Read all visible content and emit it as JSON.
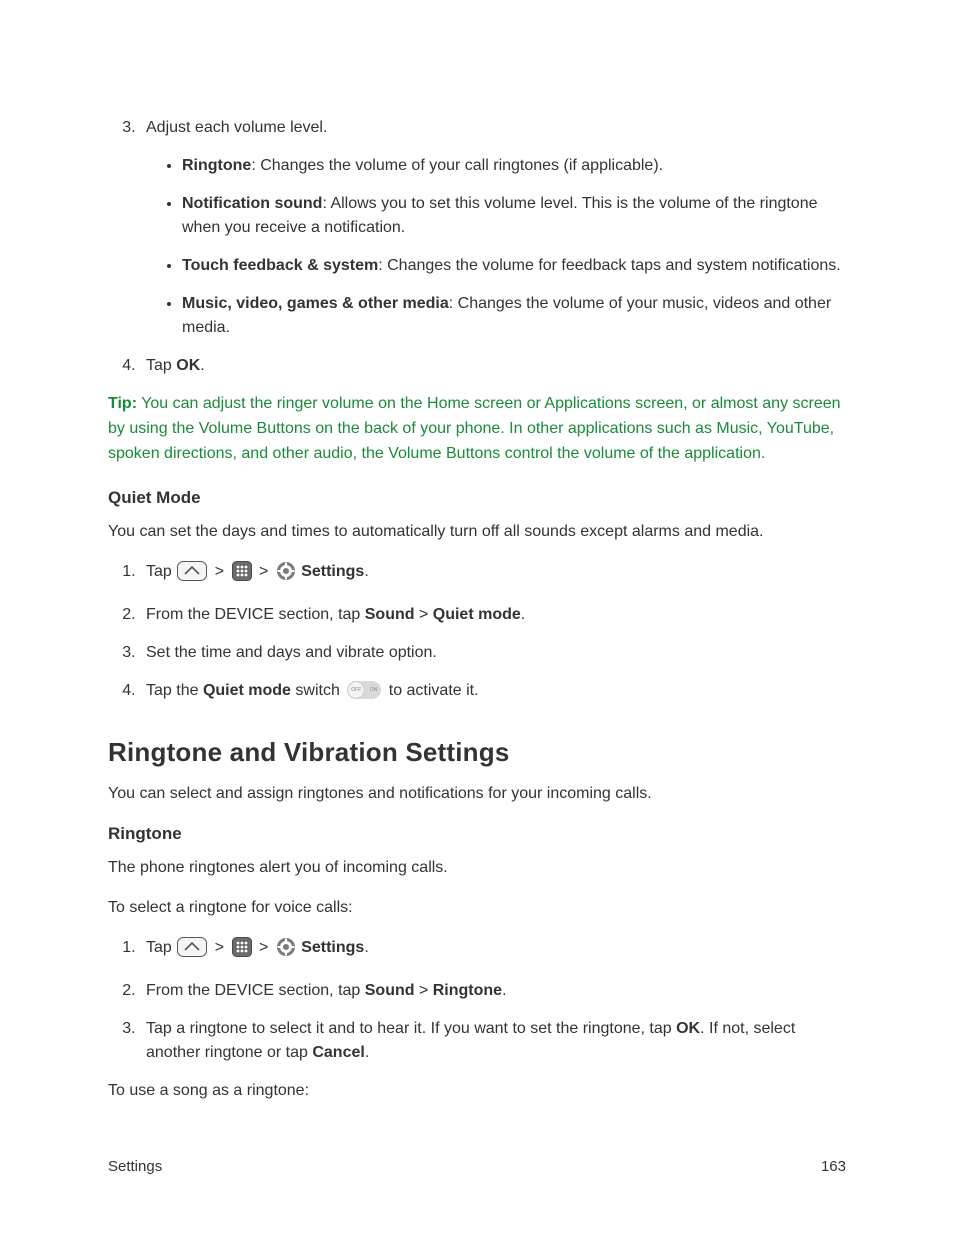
{
  "step3": {
    "lead": "Adjust each volume level.",
    "bullets": [
      {
        "term": "Ringtone",
        "desc": ": Changes the volume of your call ringtones (if applicable)."
      },
      {
        "term": "Notification sound",
        "desc": ": Allows you to set this volume level. This is the volume of the ringtone when you receive a notification."
      },
      {
        "term": "Touch feedback & system",
        "desc": ": Changes the volume for feedback taps and system notifications."
      },
      {
        "term": "Music, video, games & other media",
        "desc": ": Changes the volume of your music, videos and other media."
      }
    ]
  },
  "step4": {
    "pre": "Tap ",
    "bold": "OK",
    "post": "."
  },
  "tip": {
    "label": "Tip:",
    "body": " You can adjust the ringer volume on the Home screen or Applications screen, or almost any screen by using the Volume Buttons on the back of your phone. In other applications such as Music, YouTube, spoken directions, and other audio, the Volume Buttons control the volume of the application."
  },
  "quiet": {
    "heading": "Quiet Mode",
    "intro": "You can set the days and times to automatically turn off all sounds except alarms and media.",
    "s1": {
      "tap": "Tap ",
      "gt": ">",
      "settings": "Settings",
      "dot": "."
    },
    "s2": {
      "pre": "From the DEVICE section, tap ",
      "sound": "Sound",
      "gt": " > ",
      "qm": "Quiet mode",
      "dot": "."
    },
    "s3": "Set the time and days and vibrate option.",
    "s4": {
      "pre": "Tap the ",
      "qm": "Quiet mode",
      "mid": " switch ",
      "post": " to activate it."
    }
  },
  "rv": {
    "heading": "Ringtone and Vibration Settings",
    "intro": "You can select and assign ringtones and notifications for your incoming calls."
  },
  "ringtone": {
    "heading": "Ringtone",
    "p1": "The phone ringtones alert you of incoming calls.",
    "p2": "To select a ringtone for voice calls:",
    "s1": {
      "tap": "Tap ",
      "gt": ">",
      "settings": "Settings",
      "dot": "."
    },
    "s2": {
      "pre": "From the DEVICE section, tap ",
      "sound": "Sound",
      "gt": " > ",
      "rt": "Ringtone",
      "dot": "."
    },
    "s3": {
      "pre": "Tap a ringtone to select it and to hear it. If you want to set the ringtone, tap ",
      "ok": "OK",
      "mid": ". If not, select another ringtone or tap ",
      "cancel": "Cancel",
      "dot": "."
    },
    "p3": "To use a song as a ringtone:"
  },
  "footer": {
    "left": "Settings",
    "right": "163"
  }
}
